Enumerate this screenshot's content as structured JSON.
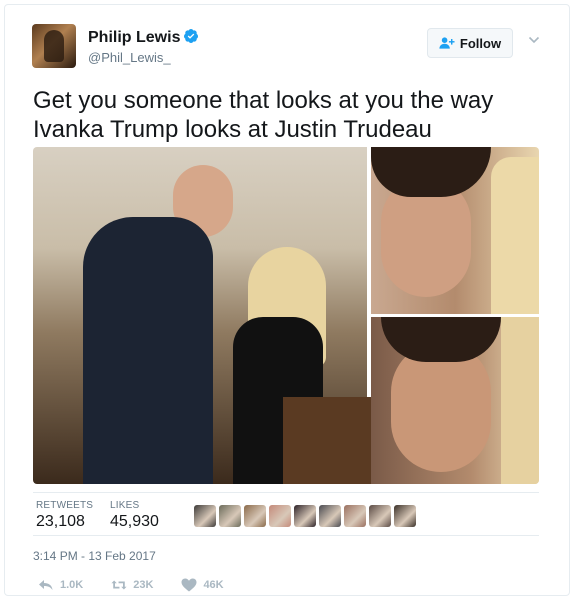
{
  "user": {
    "name": "Philip Lewis",
    "handle": "@Phil_Lewis_"
  },
  "follow": {
    "label": "Follow"
  },
  "tweet": {
    "text": "Get you someone that looks at you the way Ivanka Trump looks at Justin Trudeau"
  },
  "stats": {
    "retweets_label": "RETWEETS",
    "retweets_value": "23,108",
    "likes_label": "LIKES",
    "likes_value": "45,930"
  },
  "likers_colors": [
    "#3c3a38",
    "#6b6b5a",
    "#8a6a4a",
    "#c48a7a",
    "#2c2228",
    "#4a4a50",
    "#9a7060",
    "#5a4a44",
    "#3a3028"
  ],
  "timestamp": "3:14 PM - 13 Feb 2017",
  "actions": {
    "reply_count": "1.0K",
    "retweet_count": "23K",
    "like_count": "46K"
  },
  "colors": {
    "verified": "#1da1f2",
    "icon_gray": "#aab8c2",
    "follow_icon": "#1da1f2"
  }
}
